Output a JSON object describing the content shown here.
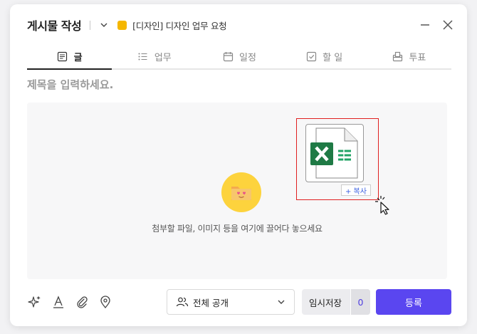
{
  "header": {
    "title": "게시물 작성",
    "project_name": "[디자인] 디자인 업무 요청",
    "project_color": "#f5b700"
  },
  "tabs": [
    {
      "label": "글",
      "icon": "document-icon",
      "active": true
    },
    {
      "label": "업무",
      "icon": "task-list-icon",
      "active": false
    },
    {
      "label": "일정",
      "icon": "calendar-icon",
      "active": false
    },
    {
      "label": "할 일",
      "icon": "checkbox-icon",
      "active": false
    },
    {
      "label": "투표",
      "icon": "ballot-box-icon",
      "active": false
    }
  ],
  "title_input": {
    "placeholder": "제목을 입력하세요.",
    "value": ""
  },
  "dropzone": {
    "text": "첨부할 파일, 이미지 등을 여기에 끌어다 놓으세요",
    "drag_file_icon": "excel-file-icon",
    "copy_badge": "+ 복사"
  },
  "footer": {
    "visibility": "전체 공개",
    "draft_label": "임시저장",
    "draft_count": "0",
    "submit_label": "등록"
  },
  "colors": {
    "accent": "#5a46f0",
    "excel_green": "#1f7a45",
    "drop_icon_bg": "#fdd33d",
    "drag_highlight": "#e02020"
  }
}
